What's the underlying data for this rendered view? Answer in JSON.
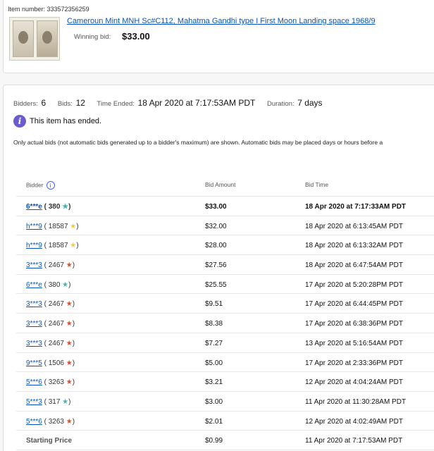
{
  "item": {
    "number_label": "Item number: 333572356259",
    "title": "Cameroun Mint MNH Sc#C112, Mahatma Gandhi type I First Moon Landing space 1968/9",
    "winning_bid_label": "Winning bid:",
    "winning_bid_value": "$33.00"
  },
  "summary": {
    "bidders_label": "Bidders:",
    "bidders_value": "6",
    "bids_label": "Bids:",
    "bids_value": "12",
    "time_ended_label": "Time Ended:",
    "time_ended_value": "18 Apr 2020 at 7:17:53AM PDT",
    "duration_label": "Duration:",
    "duration_value": "7 days"
  },
  "status": {
    "ended_text": "This item has ended."
  },
  "note": "Only actual bids (not automatic bids generated up to a bidder's maximum) are shown. Automatic bids may be placed days or hours before a",
  "table": {
    "headers": {
      "bidder": "Bidder",
      "amount": "Bid Amount",
      "time": "Bid Time"
    },
    "rows": [
      {
        "bidder": "6***e",
        "score": "380",
        "star_color": "#3fb6b0",
        "amount": "$33.00",
        "time": "18 Apr 2020 at 7:17:33AM PDT",
        "bold": true
      },
      {
        "bidder": "h***9",
        "score": "18587",
        "star_color": "#f2c94c",
        "amount": "$32.00",
        "time": "18 Apr 2020 at 6:13:45AM PDT"
      },
      {
        "bidder": "h***9",
        "score": "18587",
        "star_color": "#f2c94c",
        "amount": "$28.00",
        "time": "18 Apr 2020 at 6:13:32AM PDT"
      },
      {
        "bidder": "3***3",
        "score": "2467",
        "star_color": "#d9502f",
        "amount": "$27.56",
        "time": "18 Apr 2020 at 6:47:54AM PDT"
      },
      {
        "bidder": "6***e",
        "score": "380",
        "star_color": "#3fb6b0",
        "amount": "$25.55",
        "time": "17 Apr 2020 at 5:20:28PM PDT"
      },
      {
        "bidder": "3***3",
        "score": "2467",
        "star_color": "#d9502f",
        "amount": "$9.51",
        "time": "17 Apr 2020 at 6:44:45PM PDT"
      },
      {
        "bidder": "3***3",
        "score": "2467",
        "star_color": "#d9502f",
        "amount": "$8.38",
        "time": "17 Apr 2020 at 6:38:36PM PDT"
      },
      {
        "bidder": "3***3",
        "score": "2467",
        "star_color": "#d9502f",
        "amount": "$7.27",
        "time": "13 Apr 2020 at 5:16:54AM PDT"
      },
      {
        "bidder": "9***5",
        "score": "1506",
        "star_color": "#d9502f",
        "amount": "$5.00",
        "time": "17 Apr 2020 at 2:33:36PM PDT"
      },
      {
        "bidder": "5***6",
        "score": "3263",
        "star_color": "#d9502f",
        "amount": "$3.21",
        "time": "12 Apr 2020 at 4:04:24AM PDT"
      },
      {
        "bidder": "5***3",
        "score": "317",
        "star_color": "#3fb6b0",
        "amount": "$3.00",
        "time": "11 Apr 2020 at 11:30:28AM PDT"
      },
      {
        "bidder": "5***6",
        "score": "3263",
        "star_color": "#d9502f",
        "amount": "$2.01",
        "time": "12 Apr 2020 at 4:02:49AM PDT"
      }
    ],
    "starting": {
      "label": "Starting Price",
      "amount": "$0.99",
      "time": "11 Apr 2020 at 7:17:53AM PDT"
    }
  }
}
